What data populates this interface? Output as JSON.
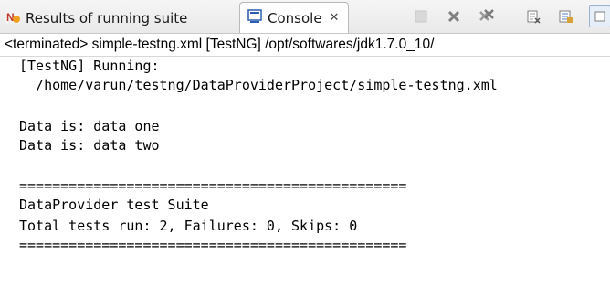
{
  "tabs": {
    "results_label": "Results of running suite",
    "console_label": "Console",
    "console_close": "✕"
  },
  "toolbar": {
    "buttons": [
      {
        "icon": "terminate-icon"
      },
      {
        "icon": "remove-launch-icon"
      },
      {
        "icon": "remove-all-terminated-icon"
      },
      {
        "icon": "clear-console-icon"
      },
      {
        "icon": "scroll-lock-icon"
      },
      {
        "icon": "word-wrap-icon"
      }
    ]
  },
  "status": {
    "text": "<terminated> simple-testng.xml [TestNG] /opt/softwares/jdk1.7.0_10/"
  },
  "console": {
    "lines": [
      "[TestNG] Running:",
      "  /home/varun/testng/DataProviderProject/simple-testng.xml",
      "",
      "Data is: data one",
      "Data is: data two",
      "",
      "===============================================",
      "DataProvider test Suite",
      "Total tests run: 2, Failures: 0, Skips: 0",
      "==============================================="
    ]
  },
  "colors": {
    "tab_bg": "#e9e9e9",
    "active_tab_bg": "#ffffff",
    "console_icon_blue": "#2a5db0"
  }
}
